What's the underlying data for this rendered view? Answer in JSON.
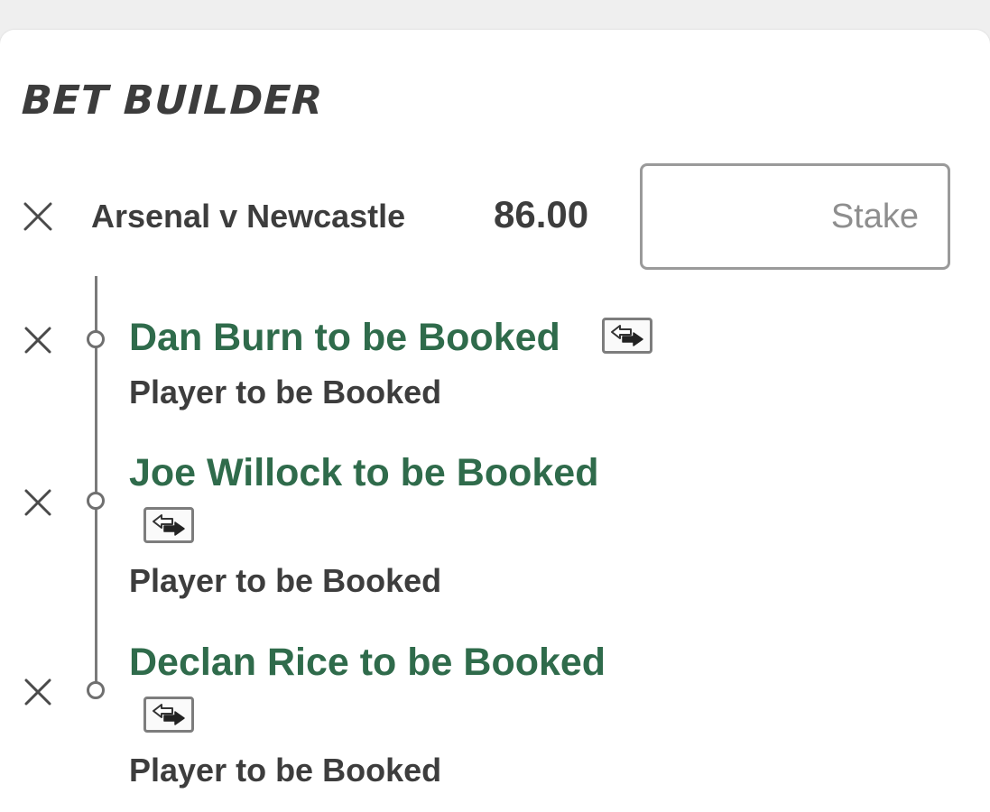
{
  "title": "BET BUILDER",
  "match": {
    "name": "Arsenal v Newcastle",
    "odds": "86.00",
    "stake_placeholder": "Stake"
  },
  "selections": [
    {
      "name": "Dan Burn to be Booked",
      "market": "Player to be Booked"
    },
    {
      "name": "Joe Willock to be Booked",
      "market": "Player to be Booked"
    },
    {
      "name": "Declan Rice to be Booked",
      "market": "Player to be Booked"
    }
  ],
  "icons": {
    "remove": "close-icon",
    "swap": "swap-arrows-icon"
  },
  "colors": {
    "selection_green": "#2f6b4b",
    "text_dark": "#3d3d3d",
    "background": "#efefef"
  }
}
